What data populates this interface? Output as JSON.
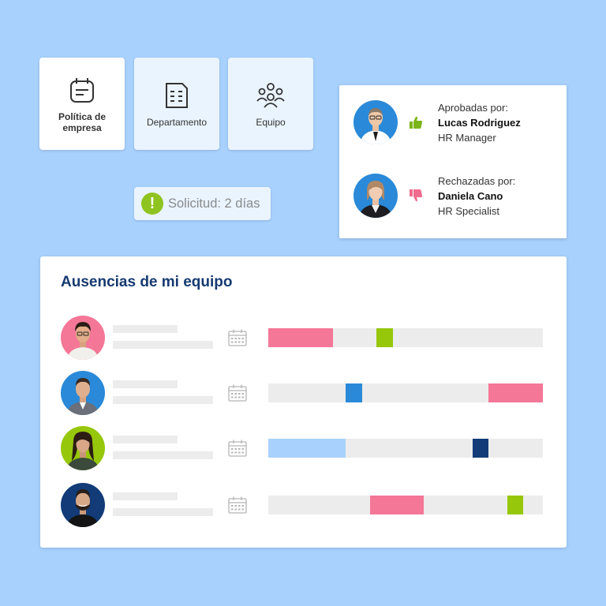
{
  "colors": {
    "background": "#a8d1fd",
    "title_blue": "#163a70",
    "pink": "#f47797",
    "green": "#97c70a",
    "blue": "#2a89d8",
    "light_blue": "#a8d1fd",
    "navy": "#123b78",
    "bar_track": "#ececec"
  },
  "categories": [
    {
      "label": "Política de empresa",
      "icon": "calendar-note-icon"
    },
    {
      "label": "Departamento",
      "icon": "building-icon"
    },
    {
      "label": "Equipo",
      "icon": "team-icon"
    }
  ],
  "request_badge": {
    "icon": "exclamation-icon",
    "text": "Solicitud: 2 días"
  },
  "approvals": [
    {
      "label": "Aprobadas por:",
      "name": "Lucas Rodriguez",
      "role": "HR Manager",
      "icon": "thumbs-up-icon"
    },
    {
      "label": "Rechazadas por:",
      "name": "Daniela Cano",
      "role": "HR Specialist",
      "icon": "thumbs-down-icon"
    }
  ],
  "team": {
    "title": "Ausencias de mi equipo",
    "members": [
      {
        "avatar_bg": "#f47797",
        "segments": [
          {
            "start": 0.0,
            "end": 0.235,
            "color": "#f47797"
          },
          {
            "start": 0.395,
            "end": 0.453,
            "color": "#97c70a"
          }
        ]
      },
      {
        "avatar_bg": "#2a89d8",
        "segments": [
          {
            "start": 0.283,
            "end": 0.342,
            "color": "#2a89d8"
          },
          {
            "start": 0.803,
            "end": 1.0,
            "color": "#f47797"
          }
        ]
      },
      {
        "avatar_bg": "#97c70a",
        "segments": [
          {
            "start": 0.0,
            "end": 0.283,
            "color": "#a8d1fd"
          },
          {
            "start": 0.745,
            "end": 0.803,
            "color": "#123b78"
          }
        ]
      },
      {
        "avatar_bg": "#123b78",
        "segments": [
          {
            "start": 0.37,
            "end": 0.567,
            "color": "#f47797"
          },
          {
            "start": 0.87,
            "end": 0.928,
            "color": "#97c70a"
          }
        ]
      }
    ]
  }
}
